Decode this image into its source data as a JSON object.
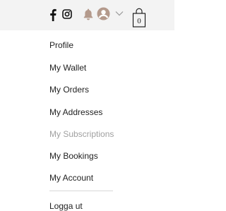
{
  "header": {
    "icons": {
      "facebook": "facebook-icon",
      "instagram": "instagram-icon",
      "notifications": "bell-icon",
      "account": "avatar-icon",
      "dropdown": "chevron-down-icon",
      "cart": "shopping-bag-icon"
    },
    "cart_count": "0",
    "colors": {
      "topbar_bg": "#f3f3f3",
      "accent": "#b49a8c",
      "icon_dark": "#111111"
    }
  },
  "menu": {
    "items": [
      {
        "label": "Profile",
        "active": false
      },
      {
        "label": "My Wallet",
        "active": false
      },
      {
        "label": "My Orders",
        "active": false
      },
      {
        "label": "My Addresses",
        "active": false
      },
      {
        "label": "My Subscriptions",
        "active": true
      },
      {
        "label": "My Bookings",
        "active": false
      },
      {
        "label": "My Account",
        "active": false
      }
    ],
    "logout_label": "Logga ut",
    "colors": {
      "text": "#222222",
      "muted_text": "#a0a0a0",
      "separator": "#d8d8d8"
    }
  }
}
